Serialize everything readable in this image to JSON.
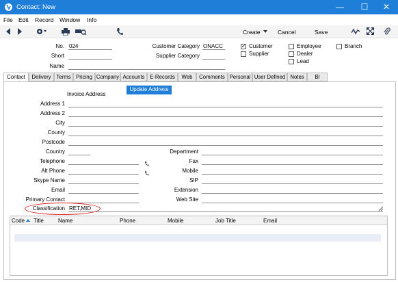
{
  "window": {
    "title": "Contact: New",
    "minimize": "—",
    "maximize": "☐",
    "close": "✕"
  },
  "menu": [
    "File",
    "Edit",
    "Record",
    "Window",
    "Info"
  ],
  "toolbar": {
    "create": "Create",
    "cancel": "Cancel",
    "save": "Save"
  },
  "header": {
    "no_label": "No.",
    "no_value": "024",
    "short_label": "Short",
    "short_value": "",
    "name_label": "Name",
    "name_value": "",
    "cust_cat_label": "Customer Category",
    "cust_cat_value": "ONACC",
    "supp_cat_label": "Supplier Category",
    "supp_cat_value": "",
    "checks": [
      {
        "label": "Customer",
        "checked": true
      },
      {
        "label": "Supplier",
        "checked": false
      },
      {
        "label": "Employee",
        "checked": false
      },
      {
        "label": "Dealer",
        "checked": false
      },
      {
        "label": "Lead",
        "checked": false
      },
      {
        "label": "Branch",
        "checked": false
      }
    ]
  },
  "tabs": [
    "Contact",
    "Delivery",
    "Terms",
    "Pricing",
    "Company",
    "Accounts",
    "E-Records",
    "Web",
    "Comments",
    "Personal",
    "User Defined",
    "Notes",
    "BI"
  ],
  "contact": {
    "invoice_address": "Invoice Address",
    "update_address": "Update Address",
    "left_fields": [
      "Address 1",
      "Address 2",
      "City",
      "County",
      "Postcode",
      "Country",
      "Telephone",
      "Alt Phone",
      "Skype Name",
      "Email",
      "Primary Contact",
      "Classification"
    ],
    "classification_value": "RET,MID",
    "right_fields": [
      "Department",
      "Fax",
      "Mobile",
      "SIP",
      "Extension",
      "Web Site"
    ]
  },
  "grid": {
    "columns": [
      "Code",
      "Title",
      "Name",
      "Phone",
      "Mobile",
      "Job Title",
      "Email"
    ]
  },
  "colors": {
    "titlebar": "#1f7fd8",
    "highlight": "#e02020"
  }
}
